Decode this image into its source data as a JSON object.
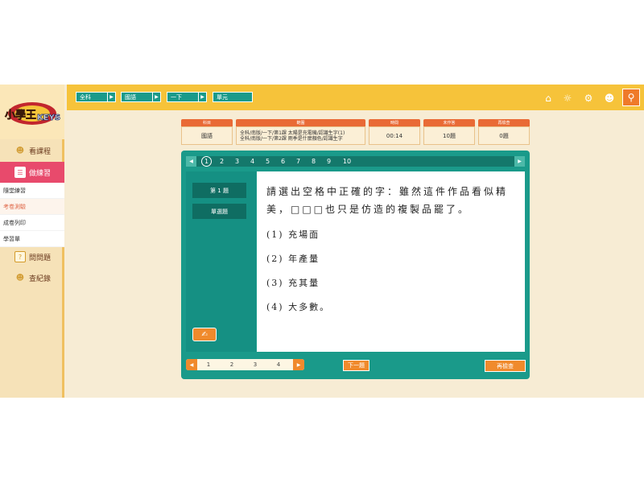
{
  "breadcrumb": [
    "全科",
    "國語",
    "一下",
    "單元"
  ],
  "icons": {
    "home": "home-icon",
    "help": "help-icon",
    "settings": "gear-icon",
    "user": "user-icon",
    "search": "search-icon"
  },
  "sidebar": {
    "logo": "小學王 KEYS",
    "courses": "看課程",
    "practice": "做練習",
    "sub_items": [
      "隨堂練習",
      "考卷測驗",
      "成卷列印",
      "學習單"
    ],
    "ask": "問問題",
    "records": "查紀錄"
  },
  "info": {
    "subject_header": "科目",
    "subject": "國語",
    "range_header": "範圍",
    "range_lines": [
      "全科/南版/一下/第1課 太陽是充電機/認識生字(1)",
      "全科/南版/一下/第2課 雨季是什麼顏色/認識生字"
    ],
    "time_header": "時間",
    "time": "00:14",
    "unanswered_header": "未作答",
    "unanswered": "10題",
    "review_header": "再檢查",
    "review": "0題"
  },
  "question_numbers": [
    "1",
    "2",
    "3",
    "4",
    "5",
    "6",
    "7",
    "8",
    "9",
    "10"
  ],
  "current_question": "1",
  "left_panel": {
    "question_label": "第 1 題",
    "type_label": "單選題",
    "draft_icon": "pen-icon"
  },
  "question": {
    "text": "請選出空格中正確的字：雖然這件作品看似精美，□□□也只是仿造的複製品罷了。",
    "options": [
      "(1) 充場面",
      "(2) 年產量",
      "(3) 充其量",
      "(4) 大多數。"
    ]
  },
  "pager": [
    "1",
    "2",
    "3",
    "4"
  ],
  "buttons": {
    "next": "下一題",
    "recheck": "再檢查"
  },
  "colors": {
    "teal": "#1a9a8a",
    "orange": "#f08a2c",
    "pink": "#e84a6c",
    "yellow": "#f6c33a"
  }
}
